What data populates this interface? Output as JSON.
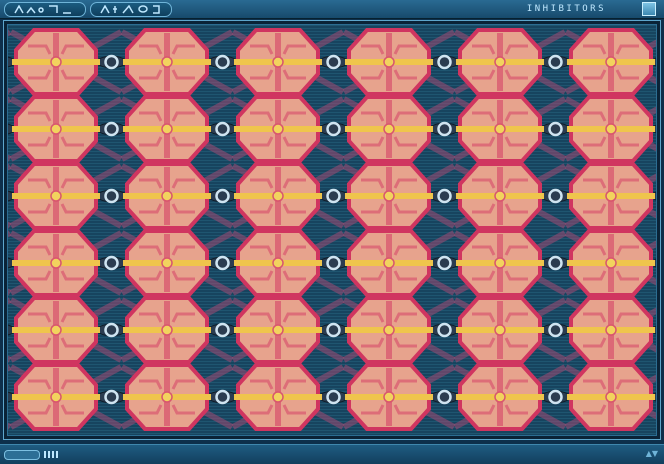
{
  "window": {
    "title": "INHIBITORS",
    "left_glyphs_icon": "alien-glyph-group-1",
    "right_glyphs_icon": "alien-glyph-group-2",
    "close_icon": "square-button-icon"
  },
  "pattern": {
    "rows": 6,
    "cols": 6,
    "colors": {
      "background": "#16405a",
      "hexagon_fill": "#e7a38d",
      "hexagon_border": "#d03560",
      "center_line": "#efc54c",
      "connector": "#4e6780",
      "eye_ring": "#cfe4f1",
      "rays": "#a34a72"
    }
  },
  "statusbar": {
    "meter_ticks": 4,
    "arrows": "▲▼"
  }
}
